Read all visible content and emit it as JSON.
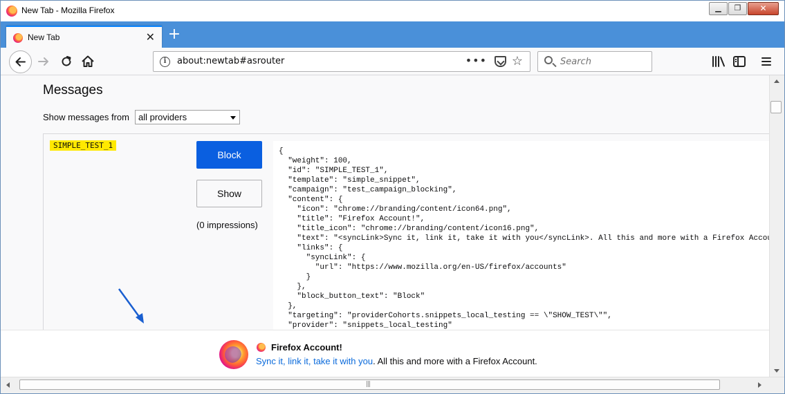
{
  "window": {
    "title": "New Tab - Mozilla Firefox"
  },
  "tab": {
    "label": "New Tab",
    "close_glyph": "✕",
    "new_tab_glyph": "+"
  },
  "wincontrols": {
    "minimize": "▁",
    "restore": "❐",
    "close": "✕"
  },
  "navbar": {
    "url": "about:newtab#asrouter",
    "info_glyph": "i",
    "page_actions_glyph": "•••",
    "star_glyph": "☆",
    "search_placeholder": "Search"
  },
  "page": {
    "title": "Messages",
    "providers_label": "Show messages from",
    "providers_selected": "all providers"
  },
  "message": {
    "id": "SIMPLE_TEST_1",
    "block_label": "Block",
    "show_label": "Show",
    "impressions": "(0 impressions)",
    "json_text": "{\n  \"weight\": 100,\n  \"id\": \"SIMPLE_TEST_1\",\n  \"template\": \"simple_snippet\",\n  \"campaign\": \"test_campaign_blocking\",\n  \"content\": {\n    \"icon\": \"chrome://branding/content/icon64.png\",\n    \"title\": \"Firefox Account!\",\n    \"title_icon\": \"chrome://branding/content/icon16.png\",\n    \"text\": \"<syncLink>Sync it, link it, take it with you</syncLink>. All this and more with a Firefox Account.\",\n    \"links\": {\n      \"syncLink\": {\n        \"url\": \"https://www.mozilla.org/en-US/firefox/accounts\"\n      }\n    },\n    \"block_button_text\": \"Block\"\n  },\n  \"targeting\": \"providerCohorts.snippets_local_testing == \\\"SHOW_TEST\\\"\",\n  \"provider\": \"snippets_local_testing\""
  },
  "snippet": {
    "title": "Firefox Account!",
    "link_text": "Sync it, link it, take it with you",
    "rest_text": ". All this and more with a Firefox Account."
  },
  "hscroll": {
    "grip": "|||"
  },
  "colors": {
    "accent": "#0a84ff",
    "block_button": "#0a5fe0",
    "highlight": "#ffe900",
    "link": "#0a6adb"
  }
}
